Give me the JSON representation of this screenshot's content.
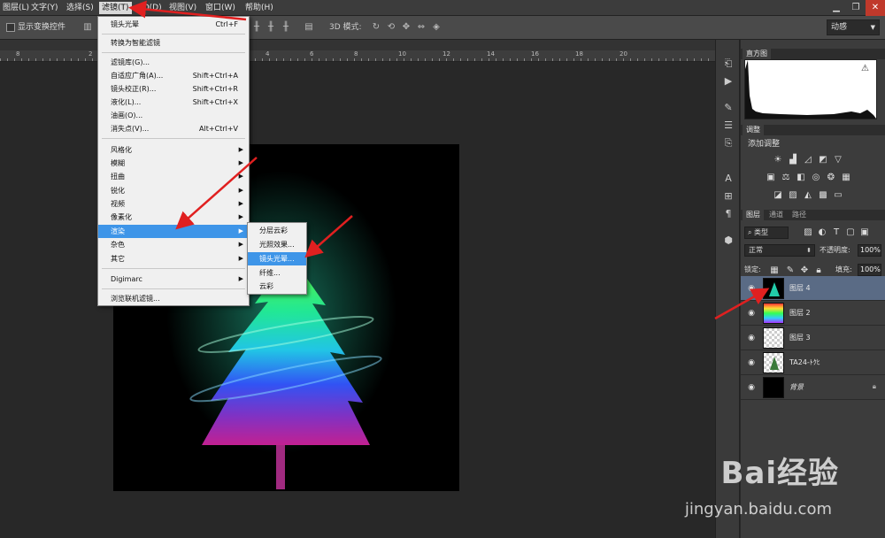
{
  "menubar": {
    "items": [
      "图层(L)",
      "文字(Y)",
      "选择(S)",
      "滤镜(T)",
      "3D(D)",
      "视图(V)",
      "窗口(W)",
      "帮助(H)"
    ],
    "active": "滤镜(T)"
  },
  "options": {
    "transform_label": "显示变换控件",
    "mode_3d": "3D 模式:",
    "workspace": "动感"
  },
  "ruler": {
    "numbers": [
      "8",
      "2",
      "4",
      "6",
      "8",
      "10",
      "12",
      "14",
      "16",
      "18",
      "20"
    ]
  },
  "filter_menu": {
    "last_filter": "镜头光晕",
    "last_filter_key": "Ctrl+F",
    "smart": "转换为智能滤镜",
    "gallery": "滤镜库(G)...",
    "adaptive": "自适应广角(A)...",
    "adaptive_key": "Shift+Ctrl+A",
    "lens_corr": "镜头校正(R)...",
    "lens_corr_key": "Shift+Ctrl+R",
    "liquify": "液化(L)...",
    "liquify_key": "Shift+Ctrl+X",
    "oil": "油画(O)...",
    "vanish": "消失点(V)...",
    "vanish_key": "Alt+Ctrl+V",
    "stylize": "风格化",
    "blur": "模糊",
    "distort": "扭曲",
    "sharpen": "锐化",
    "video": "视频",
    "pixelate": "像素化",
    "render": "渲染",
    "noise": "杂色",
    "other": "其它",
    "digimarc": "Digimarc",
    "browse": "浏览联机滤镜..."
  },
  "render_submenu": {
    "diff_clouds": "分层云彩",
    "lighting": "光照效果...",
    "lens_flare": "镜头光晕...",
    "fibers": "纤维...",
    "clouds": "云彩"
  },
  "panels": {
    "histogram_tab": "直方图",
    "adjust_tab": "调整",
    "adjust_title": "添加调整",
    "layers_tab": "图层",
    "channels_tab": "通道",
    "paths_tab": "路径",
    "filter_kind": "类型",
    "blend_mode": "正常",
    "opacity_label": "不透明度:",
    "opacity": "100%",
    "lock_label": "锁定:",
    "fill_label": "填充:",
    "fill": "100%"
  },
  "layers": [
    {
      "name": "图层 4",
      "selected": true
    },
    {
      "name": "图层 2",
      "selected": false
    },
    {
      "name": "图层 3",
      "selected": false
    },
    {
      "name": "TA24-ﾄｸﾋ",
      "selected": false
    },
    {
      "name": "背景",
      "selected": false,
      "locked": true
    }
  ],
  "watermark": {
    "brand": "Bai经验",
    "url": "jingyan.baidu.com"
  }
}
